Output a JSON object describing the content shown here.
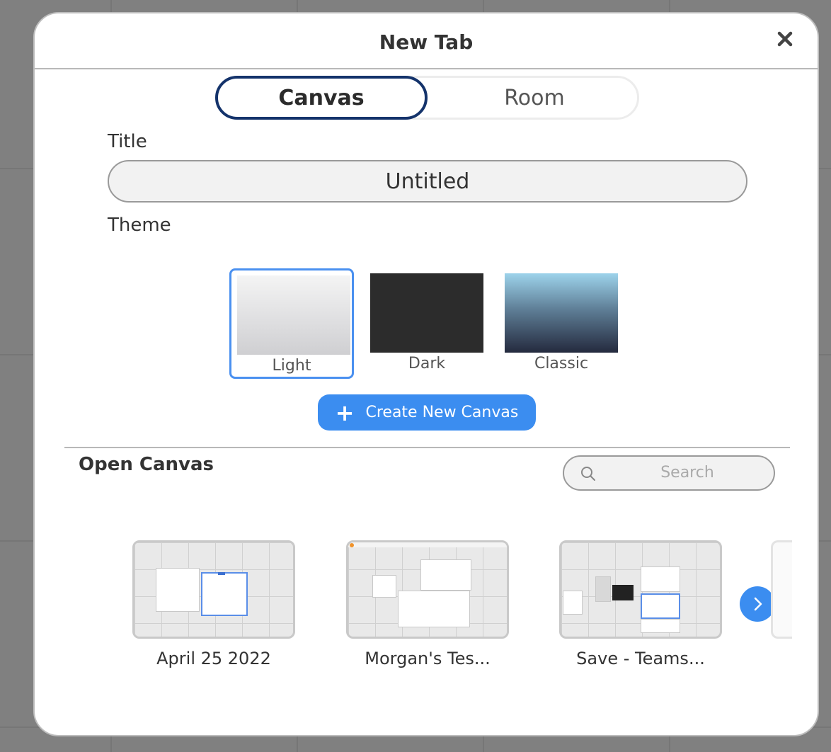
{
  "dialog": {
    "title": "New Tab",
    "close_icon": "close-icon"
  },
  "tabs": [
    {
      "label": "Canvas",
      "active": true
    },
    {
      "label": "Room",
      "active": false
    }
  ],
  "form": {
    "title_label": "Title",
    "title_value": "Untitled",
    "theme_label": "Theme"
  },
  "themes": [
    {
      "name": "Light",
      "selected": true
    },
    {
      "name": "Dark",
      "selected": false
    },
    {
      "name": "Classic",
      "selected": false
    }
  ],
  "create_button": {
    "label": "Create New Canvas",
    "icon": "plus-icon"
  },
  "open_canvas": {
    "title": "Open Canvas",
    "search_placeholder": "Search",
    "items": [
      {
        "label": "April 25 2022"
      },
      {
        "label": "Morgan's Tes..."
      },
      {
        "label": "Save - Teams..."
      }
    ],
    "next_icon": "chevron-right-icon"
  },
  "colors": {
    "accent": "#3b8df0",
    "active_tab_border": "#14336b",
    "selected_theme_border": "#4a90f0"
  }
}
